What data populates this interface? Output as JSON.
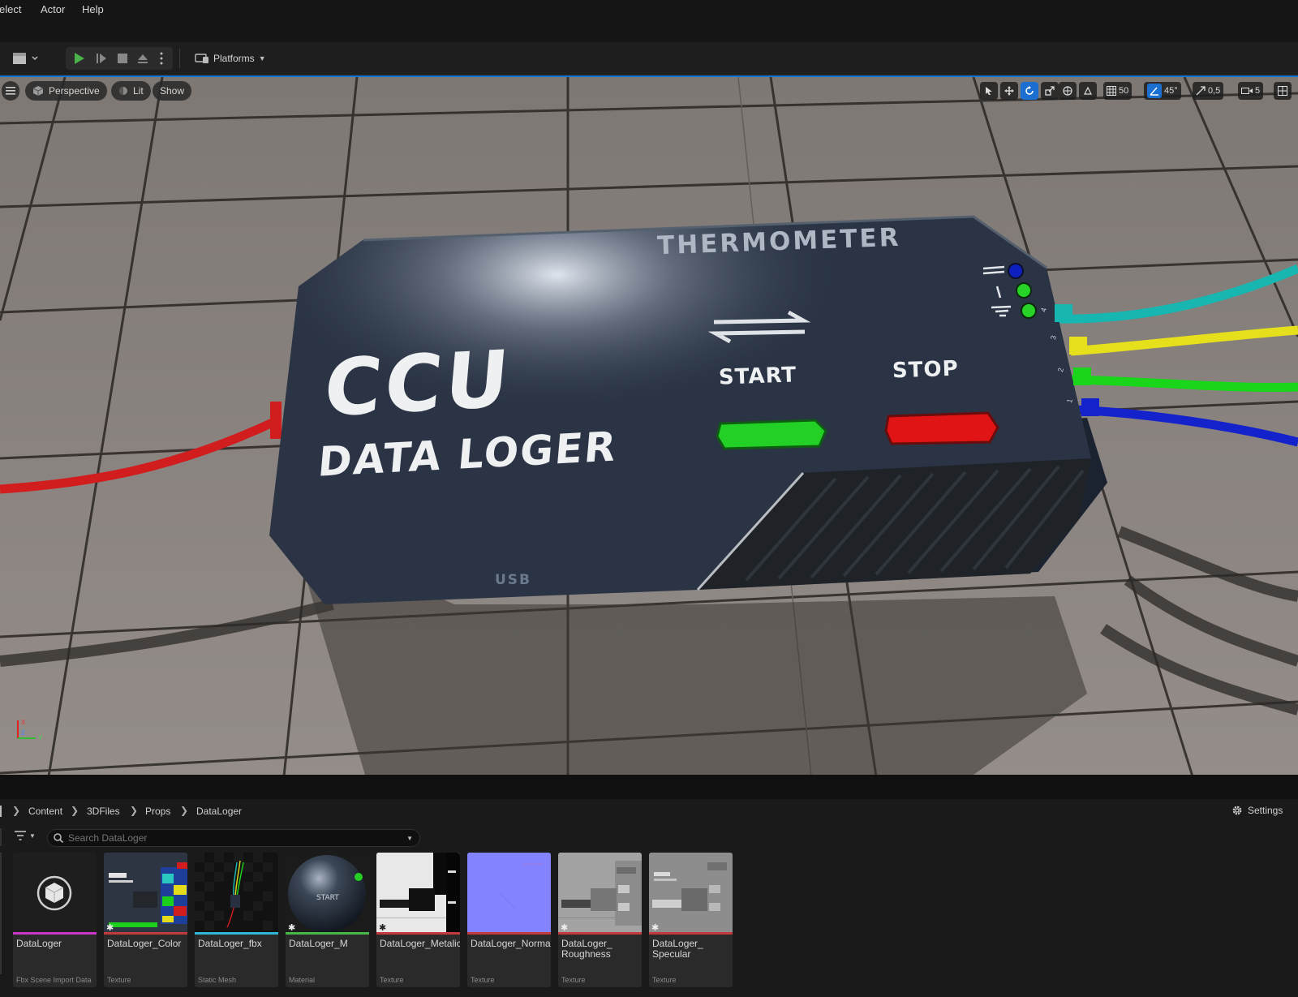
{
  "menu": [
    "elect",
    "Actor",
    "Help"
  ],
  "toolbar": {
    "platforms_label": "Platforms"
  },
  "viewport": {
    "view_mode": "Perspective",
    "lighting": "Lit",
    "show": "Show",
    "grid_snap": "50",
    "rotation_snap": "45°",
    "scale_snap": "0,5",
    "camera_speed": "5",
    "device": {
      "brand": "THERMOMETER",
      "title": "CCU",
      "subtitle": "DATA LOGER",
      "start": "START",
      "stop": "STOP",
      "usb": "USB",
      "port_numbers": [
        "4",
        "3",
        "2",
        "1"
      ]
    },
    "axes": {
      "x": "X",
      "y": "Y",
      "z": "Z"
    }
  },
  "content_browser": {
    "breadcrumb": [
      "Content",
      "3DFiles",
      "Props",
      "DataLoger"
    ],
    "settings_label": "Settings",
    "search_placeholder": "Search DataLoger",
    "assets": [
      {
        "name": "DataLoger",
        "type": "Fbx Scene Import Data",
        "color": "#c837c8"
      },
      {
        "name": "DataLoger_Color",
        "type": "Texture",
        "color": "#c23a3a"
      },
      {
        "name": "DataLoger_fbx",
        "type": "Static Mesh",
        "color": "#2fb8d6"
      },
      {
        "name": "DataLoger_M",
        "type": "Material",
        "color": "#49b649"
      },
      {
        "name": "DataLoger_Metalic",
        "type": "Texture",
        "color": "#c23a3a"
      },
      {
        "name": "DataLoger_Normal",
        "type": "Texture",
        "color": "#c23a3a"
      },
      {
        "name": "DataLoger_\nRoughness",
        "type": "Texture",
        "color": "#c23a3a"
      },
      {
        "name": "DataLoger_\nSpecular",
        "type": "Texture",
        "color": "#c23a3a"
      }
    ]
  }
}
